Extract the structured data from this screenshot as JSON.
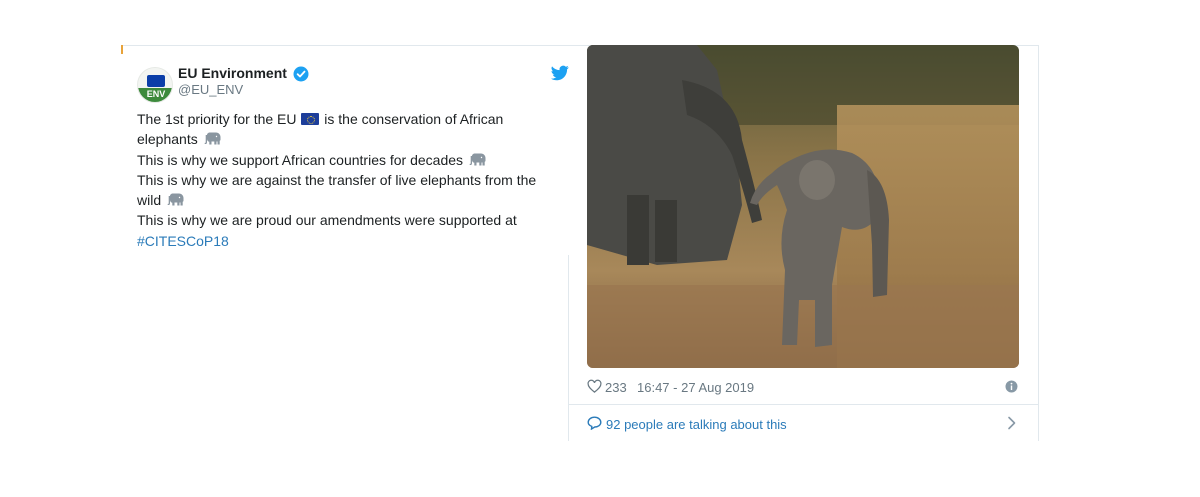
{
  "tweet": {
    "author": {
      "name": "EU Environment",
      "handle": "@EU_ENV",
      "avatar_label": "ENV",
      "verified": true
    },
    "text_lines": [
      {
        "before": "The 1st priority for the EU ",
        "after": " is the conservation of African"
      },
      {
        "text": "elephants"
      },
      {
        "text": "This is why we support African countries for decades"
      },
      {
        "text": "This is why we are against the transfer of live elephants from the"
      },
      {
        "text": "wild"
      },
      {
        "text": "This is why we are proud our amendments were supported at"
      }
    ],
    "hashtag": "#CITESCoP18",
    "emoji": {
      "flag": "eu-flag-icon",
      "elephant": "elephant-icon"
    },
    "likes": "233",
    "timestamp": "16:47 - 27 Aug 2019",
    "talking": "92 people are talking about this"
  },
  "colors": {
    "link": "#2b7bb9",
    "twitter_blue": "#1da1f2",
    "meta_gray": "#697882",
    "border": "#e1e8ed",
    "accent": "#e8a33a"
  }
}
